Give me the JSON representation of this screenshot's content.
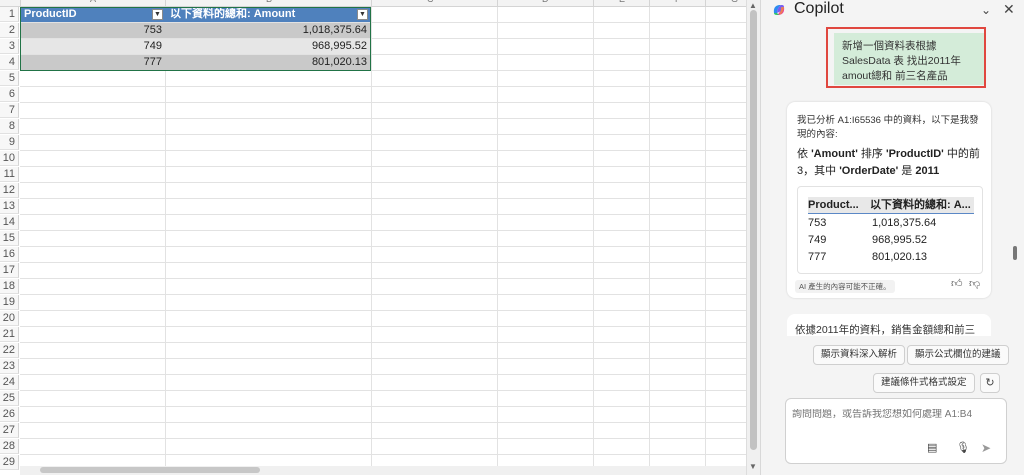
{
  "sheet": {
    "col_letters": [
      "A",
      "B",
      "C",
      "D",
      "E",
      "F",
      "G"
    ],
    "row_numbers": [
      "1",
      "2",
      "3",
      "4",
      "5",
      "6",
      "7",
      "8",
      "9",
      "10",
      "11",
      "12",
      "13",
      "14",
      "15",
      "16",
      "17",
      "18",
      "19",
      "20",
      "21",
      "22",
      "23",
      "24",
      "25",
      "26",
      "27",
      "28",
      "29"
    ],
    "headers": [
      "ProductID",
      "以下資料的總和: Amount"
    ],
    "rows": [
      [
        "753",
        "1,018,375.64"
      ],
      [
        "749",
        "968,995.52"
      ],
      [
        "777",
        "801,020.13"
      ]
    ],
    "colors": {
      "header": "#4f81bd",
      "band_dark": "#c9c9c9",
      "band_light": "#e6e6e6",
      "selection": "#217346"
    }
  },
  "copilot": {
    "title": "Copilot",
    "user_message": "新增一個資料表根據 SalesData 表 找出2011年 amout總和 前三名產品",
    "ai_intro": "我已分析 A1:I65536 中的資料，以下是我發現的內容:",
    "ai_summary": {
      "p1": "依 ",
      "k1": "'Amount'",
      "p2": " 排序 ",
      "k2": "'ProductID'",
      "p3": " 中的前 3，其中 ",
      "k3": "'OrderDate'",
      "p4": " 是 ",
      "k4": "2011"
    },
    "ai_table": {
      "headers": [
        "Product...",
        "以下資料的總和: A..."
      ],
      "rows": [
        [
          "753",
          "1,018,375.64"
        ],
        [
          "749",
          "968,995.52"
        ],
        [
          "777",
          "801,020.13"
        ]
      ]
    },
    "disclaimer": "AI 產生的內容可能不正確。",
    "next_message_preview": "依據2011年的資料，銷售金額總和前三",
    "suggestions": [
      "顯示資料深入解析",
      "顯示公式欄位的建議",
      "建議條件式格式設定"
    ],
    "input_placeholder": "詢問問題，或告訴我您想如何處理 A1:B4",
    "colors": {
      "user_bubble": "#d4ecd9",
      "highlight_border": "#e0473f"
    }
  }
}
